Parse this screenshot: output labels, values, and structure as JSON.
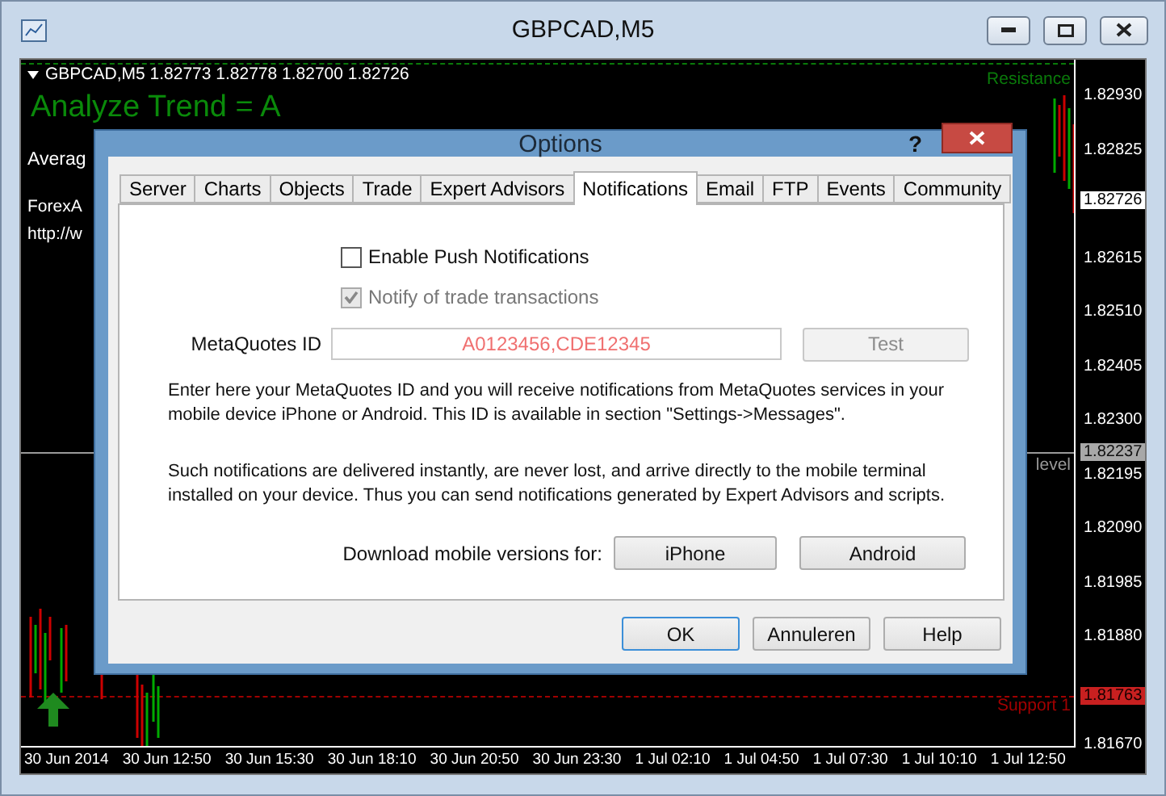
{
  "window": {
    "title": "GBPCAD,M5"
  },
  "chart": {
    "symbol": "GBPCAD,M5",
    "quote": "1.82773 1.82778 1.82700 1.82726",
    "indicator": "Analyze Trend = A",
    "lines": [
      "Averag",
      "ForexA",
      "http://w"
    ],
    "levels": [
      {
        "label": "Resistance",
        "kind": "resistance"
      },
      {
        "label": "level",
        "kind": "level"
      },
      {
        "label": "Support 1",
        "kind": "support"
      }
    ],
    "prices": [
      {
        "value": "1.82930",
        "kind": "plain"
      },
      {
        "value": "1.82825",
        "kind": "plain"
      },
      {
        "value": "1.82726",
        "kind": "current"
      },
      {
        "value": "1.82615",
        "kind": "plain"
      },
      {
        "value": "1.82510",
        "kind": "plain"
      },
      {
        "value": "1.82405",
        "kind": "plain"
      },
      {
        "value": "1.82300",
        "kind": "plain"
      },
      {
        "value": "1.82237",
        "kind": "level"
      },
      {
        "value": "1.82195",
        "kind": "plain"
      },
      {
        "value": "1.82090",
        "kind": "plain"
      },
      {
        "value": "1.81985",
        "kind": "plain"
      },
      {
        "value": "1.81880",
        "kind": "plain"
      },
      {
        "value": "1.81763",
        "kind": "support"
      },
      {
        "value": "1.81670",
        "kind": "plain"
      }
    ],
    "times": [
      "30 Jun 2014",
      "30 Jun 12:50",
      "30 Jun 15:30",
      "30 Jun 18:10",
      "30 Jun 20:50",
      "30 Jun 23:30",
      "1 Jul 02:10",
      "1 Jul 04:50",
      "1 Jul 07:30",
      "1 Jul 10:10",
      "1 Jul 12:50"
    ]
  },
  "dialog": {
    "title": "Options",
    "help": "?",
    "tabs": [
      {
        "label": "Server",
        "selected": false
      },
      {
        "label": "Charts",
        "selected": false
      },
      {
        "label": "Objects",
        "selected": false
      },
      {
        "label": "Trade",
        "selected": false
      },
      {
        "label": "Expert Advisors",
        "selected": false
      },
      {
        "label": "Notifications",
        "selected": true
      },
      {
        "label": "Email",
        "selected": false
      },
      {
        "label": "FTP",
        "selected": false
      },
      {
        "label": "Events",
        "selected": false
      },
      {
        "label": "Community",
        "selected": false
      }
    ],
    "checkboxes": [
      {
        "label": "Enable Push Notifications",
        "checked": false,
        "disabled": false
      },
      {
        "label": "Notify of trade transactions",
        "checked": true,
        "disabled": true
      }
    ],
    "id_field": {
      "label": "MetaQuotes ID",
      "value": "A0123456,CDE12345"
    },
    "test_button": {
      "label": "Test",
      "disabled": true
    },
    "paragraphs": [
      "Enter here your MetaQuotes ID and you will receive notifications from MetaQuotes services in your mobile device iPhone or Android. This ID is available in section \"Settings->Messages\".",
      "Such notifications are delivered instantly, are never lost, and arrive directly to the mobile terminal installed on your device. Thus you can send notifications generated by Expert Advisors and scripts."
    ],
    "download": {
      "label": "Download mobile versions for:",
      "buttons": [
        "iPhone",
        "Android"
      ]
    },
    "buttons": [
      {
        "label": "OK",
        "default": true
      },
      {
        "label": "Annuleren",
        "default": false
      },
      {
        "label": "Help",
        "default": false
      }
    ]
  }
}
